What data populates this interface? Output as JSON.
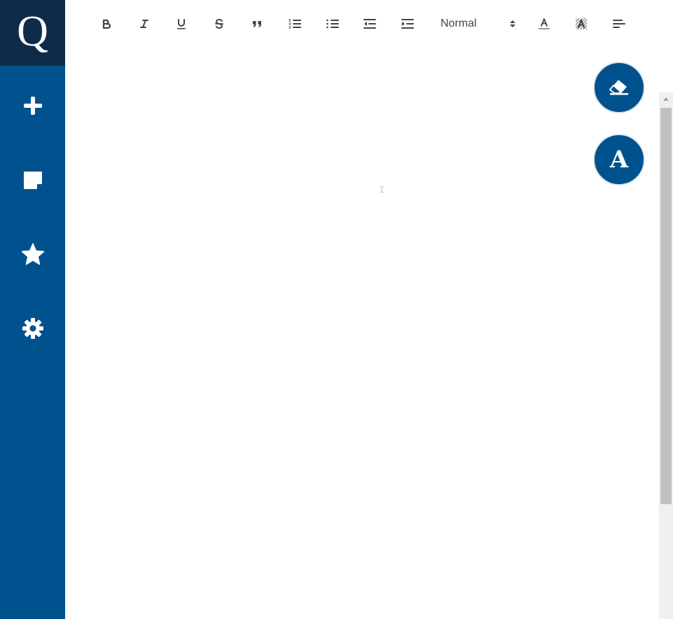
{
  "app": {
    "logo_letter": "Q"
  },
  "sidebar": {
    "items": [
      {
        "name": "new-note",
        "icon": "plus-icon"
      },
      {
        "name": "notes",
        "icon": "sticky-note-icon"
      },
      {
        "name": "favorites",
        "icon": "star-icon"
      },
      {
        "name": "settings",
        "icon": "gear-icon"
      }
    ]
  },
  "toolbar": {
    "buttons": [
      "bold-icon",
      "italic-icon",
      "underline-icon",
      "strikethrough-icon",
      "blockquote-icon",
      "ordered-list-icon",
      "bullet-list-icon",
      "outdent-icon",
      "indent-icon",
      "text-color-icon",
      "background-color-icon",
      "align-left-icon"
    ],
    "format_select": {
      "value": "Normal"
    }
  },
  "fabs": {
    "clear": {
      "icon": "eraser-icon"
    },
    "font": {
      "icon": "font-icon",
      "label": "A"
    }
  },
  "editor": {
    "content": ""
  },
  "colors": {
    "sidebar": "#00528f",
    "logo_bg": "#0d2c4a",
    "icon_gray": "#444444",
    "scrollbar_track": "#f0f0f0",
    "scrollbar_thumb": "#c1c1c1"
  }
}
